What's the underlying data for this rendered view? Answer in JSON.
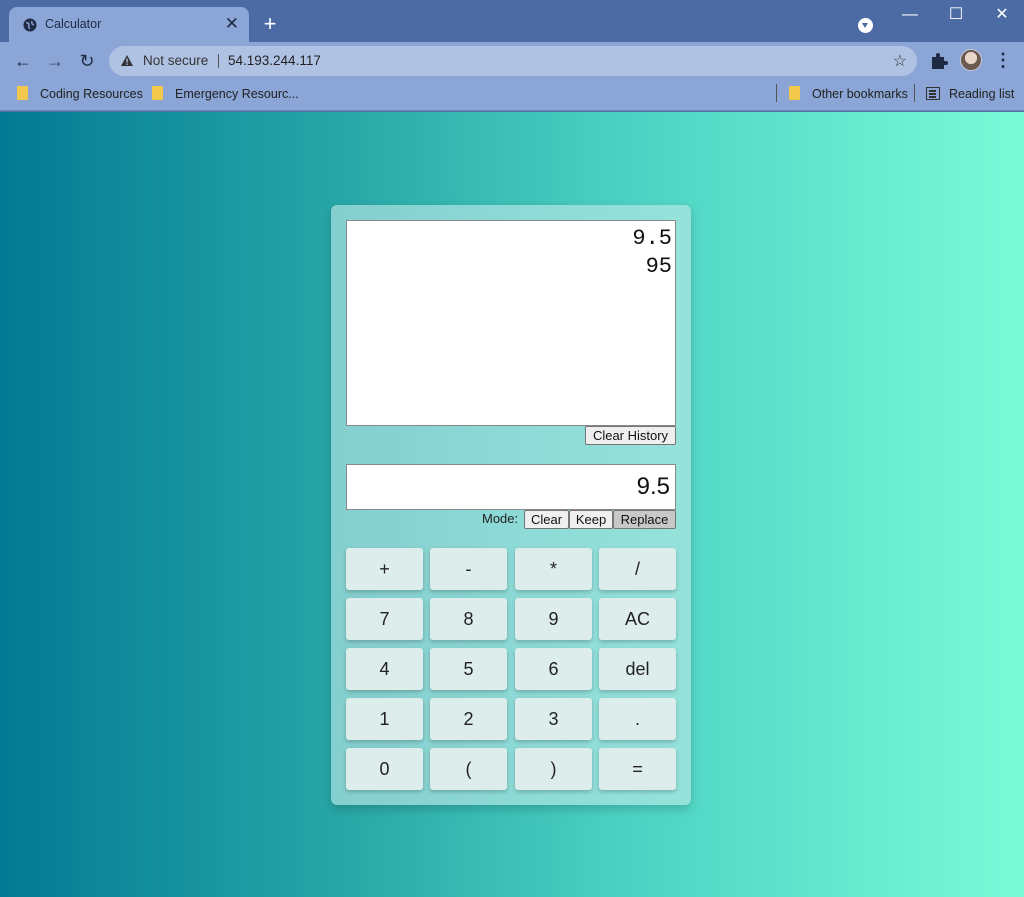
{
  "browser": {
    "tab_title": "Calculator",
    "tab_close": "✕",
    "new_tab": "+",
    "not_secure": "Not secure",
    "url": "54.193.244.117",
    "bookmarks": [
      "Coding Resources",
      "Emergency Resourc..."
    ],
    "other_bookmarks": "Other bookmarks",
    "reading_list": "Reading list",
    "window_controls": [
      "—",
      "☐",
      "✕"
    ],
    "nav": {
      "back": "←",
      "forward": "→",
      "reload": "↻"
    },
    "star": "☆",
    "menu": "⋮"
  },
  "calculator": {
    "history": [
      "9.5",
      "95"
    ],
    "clear_history_label": "Clear History",
    "display_value": "9.5",
    "mode_label": "Mode:",
    "mode_buttons": [
      "Clear",
      "Keep",
      "Replace"
    ],
    "selected_mode": "Replace",
    "keys": [
      [
        "+",
        "-",
        "*",
        "/"
      ],
      [
        "7",
        "8",
        "9",
        "AC"
      ],
      [
        "4",
        "5",
        "6",
        "del"
      ],
      [
        "1",
        "2",
        "3",
        "."
      ],
      [
        "0",
        "(",
        ")",
        "="
      ]
    ]
  },
  "colors": {
    "page_gradient_start": "#027a94",
    "page_gradient_end": "#7afbd7",
    "selected_mode_bg": "#c8c8c8"
  }
}
